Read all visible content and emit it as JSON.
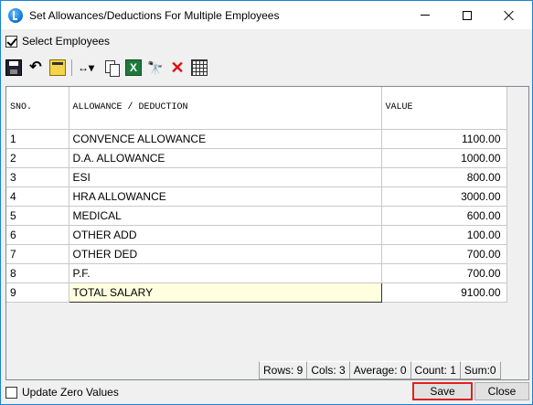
{
  "window": {
    "title": "Set Allowances/Deductions For Multiple Employees"
  },
  "options": {
    "select_employees_label": "Select Employees",
    "select_employees_checked": true
  },
  "toolbar": {
    "icons": [
      "save-icon",
      "undo-icon",
      "edit-icon",
      "move-arrows-icon",
      "copy-icon",
      "excel-icon",
      "binoculars-icon",
      "delete-icon",
      "grid-icon"
    ]
  },
  "grid": {
    "columns": [
      "SNO.",
      "ALLOWANCE / DEDUCTION",
      "VALUE"
    ],
    "rows": [
      {
        "sno": "1",
        "name": "CONVENCE ALLOWANCE",
        "value": "1100.00"
      },
      {
        "sno": "2",
        "name": "D.A. ALLOWANCE",
        "value": "1000.00"
      },
      {
        "sno": "3",
        "name": "ESI",
        "value": "800.00"
      },
      {
        "sno": "4",
        "name": "HRA ALLOWANCE",
        "value": "3000.00"
      },
      {
        "sno": "5",
        "name": "MEDICAL",
        "value": "600.00"
      },
      {
        "sno": "6",
        "name": "OTHER ADD",
        "value": "100.00"
      },
      {
        "sno": "7",
        "name": "OTHER DED",
        "value": "700.00"
      },
      {
        "sno": "8",
        "name": "P.F.",
        "value": "700.00"
      },
      {
        "sno": "9",
        "name": "TOTAL SALARY",
        "value": "9100.00"
      }
    ]
  },
  "status": {
    "rows": "Rows: 9",
    "cols": "Cols: 3",
    "average": "Average: 0",
    "count": "Count: 1",
    "sum": "Sum:0"
  },
  "footer": {
    "update_zero_label": "Update Zero Values",
    "update_zero_checked": false,
    "save_label": "Save",
    "close_label": "Close"
  }
}
